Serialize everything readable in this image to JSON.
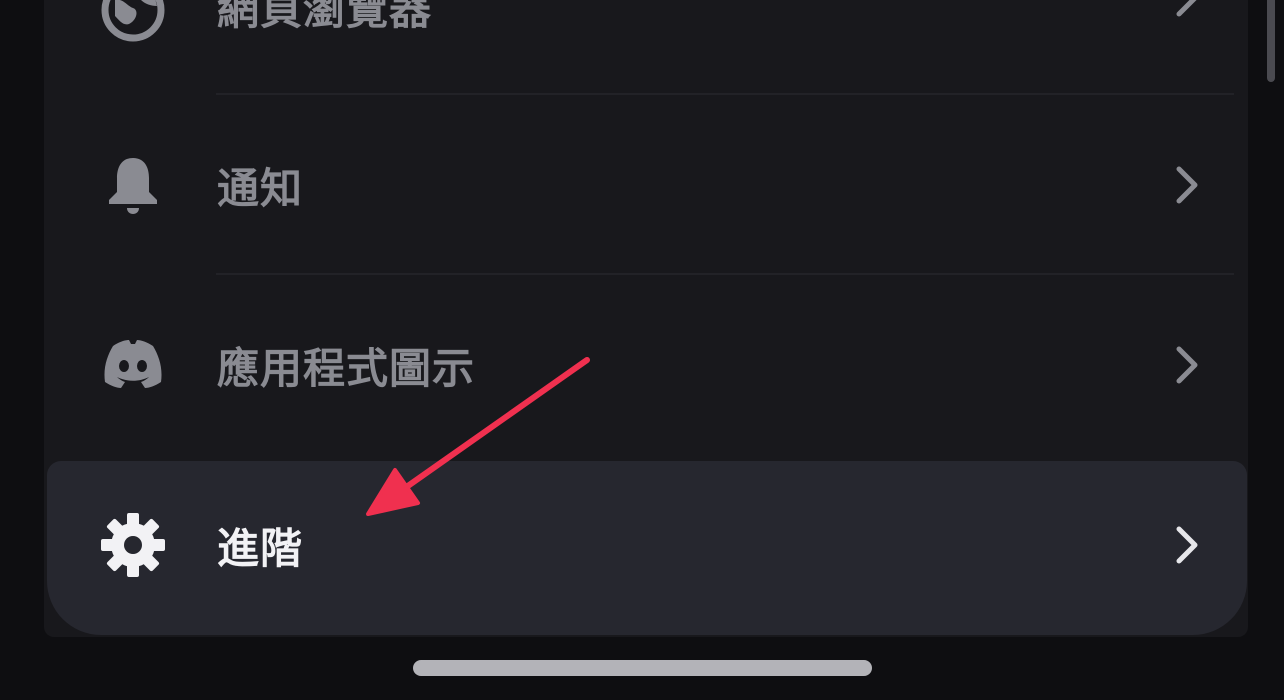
{
  "settings_list": {
    "items": [
      {
        "label": "網頁瀏覽器",
        "icon": "globe-icon"
      },
      {
        "label": "通知",
        "icon": "bell-icon"
      },
      {
        "label": "應用程式圖示",
        "icon": "discord-icon"
      },
      {
        "label": "進階",
        "icon": "gear-icon",
        "highlighted": true
      }
    ]
  },
  "annotation": {
    "type": "arrow",
    "color": "#f0304f",
    "points_to": "進階"
  },
  "colors": {
    "background": "#0e0e11",
    "panel": "#18181c",
    "highlighted_row": "#26272f",
    "muted_text": "#8a8b92",
    "active_text": "#f2f2f5"
  }
}
